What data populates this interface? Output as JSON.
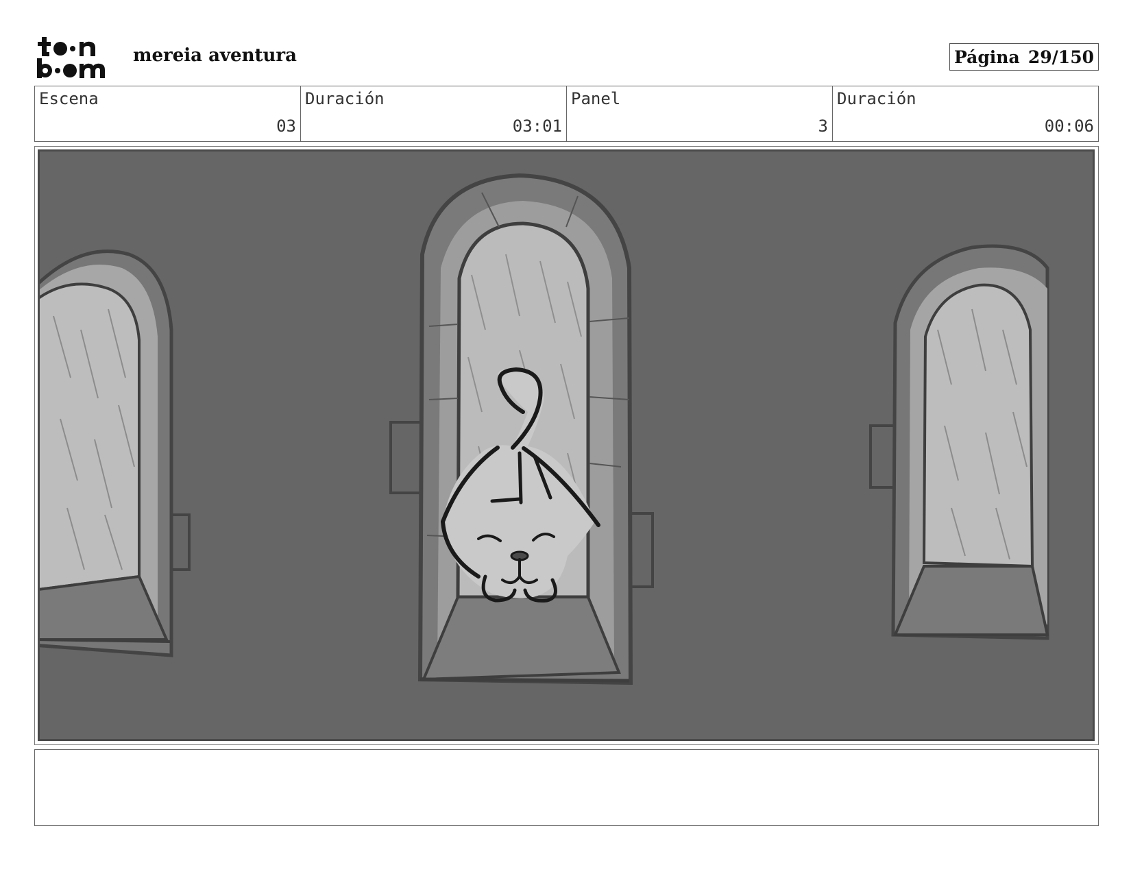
{
  "header": {
    "logo_text": "toon boom",
    "project_title": "mereia aventura",
    "page_label": "Página",
    "page_number": "29/150"
  },
  "info": {
    "scene_label": "Escena",
    "scene_value": "03",
    "scene_duration_label": "Duración",
    "scene_duration_value": "03:01",
    "panel_label": "Panel",
    "panel_value": "3",
    "panel_duration_label": "Duración",
    "panel_duration_value": "00:06"
  },
  "notes": {
    "text": ""
  }
}
